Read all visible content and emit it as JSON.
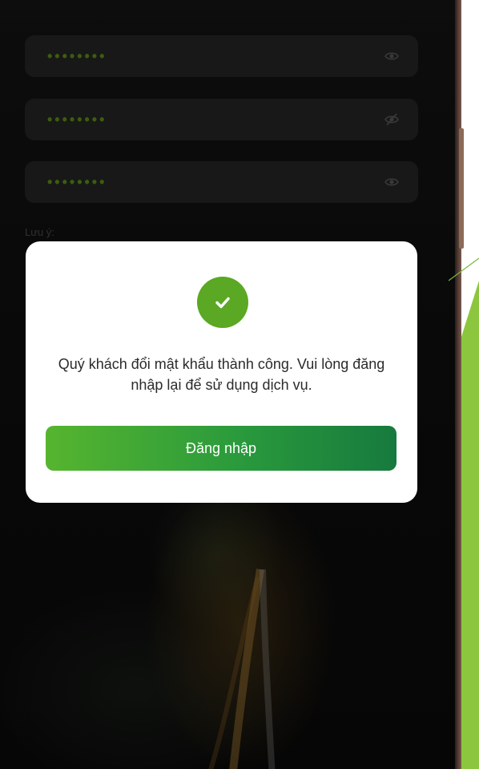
{
  "login_form": {
    "fields": [
      {
        "masked_value": "••••••••",
        "icon": "eye-icon"
      },
      {
        "masked_value": "••••••••",
        "icon": "eye-off-icon"
      },
      {
        "masked_value": "••••••••",
        "icon": "eye-icon"
      }
    ],
    "note_label": "Lưu ý:"
  },
  "dialog": {
    "icon": "check-circle-icon",
    "message": "Quý khách đổi mật khẩu thành công. Vui lòng đăng nhập lại để sử dụng dịch vụ.",
    "button_label": "Đăng nhập"
  },
  "colors": {
    "accent_green": "#5aa823",
    "button_gradient_start": "#56b52f",
    "button_gradient_end": "#167a3e",
    "masked_dots": "#5d8f18"
  }
}
